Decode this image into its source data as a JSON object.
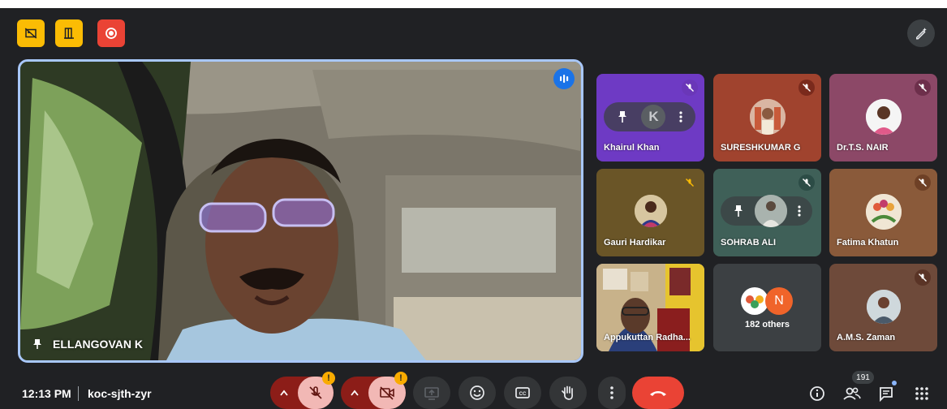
{
  "meeting": {
    "time": "12:13 PM",
    "code": "koc-sjth-zyr"
  },
  "colors": {
    "accent": "#a8c7fa",
    "hangup": "#ea4335",
    "warn": "#f9ab00",
    "yellow_chip": "#fbbc04",
    "red_chip": "#ea4335",
    "bg": "#202124"
  },
  "top_chips": [
    {
      "icon": "video-off-icon"
    },
    {
      "icon": "door-exit-icon"
    },
    {
      "icon": "record-icon"
    }
  ],
  "main_speaker": {
    "name": "ELLANGOVAN K",
    "icon": "pin-icon"
  },
  "participants": [
    {
      "name": "Khairul Khan",
      "initial": "K",
      "bg": "#6e3ac4",
      "mute_bg": "#6a37b8"
    },
    {
      "name": "SURESHKUMAR G",
      "bg": "#a0432e",
      "mute_bg": "#7a2a1c"
    },
    {
      "name": "Dr.T.S. NAIR",
      "bg": "#8c4867",
      "mute_bg": "#6d2f4b"
    },
    {
      "name": "Gauri Hardikar",
      "bg": "#6a5527",
      "mute_bg": "#6a5527"
    },
    {
      "name": "SOHRAB ALI",
      "bg": "#3f6058",
      "mute_bg": "#2c4c46"
    },
    {
      "name": "Fatima Khatun",
      "bg": "#8a5a3a",
      "mute_bg": "#6e4026"
    },
    {
      "name": "Appukuttan Radha...",
      "bg": "#a08a6c"
    },
    {
      "others_label": "182 others",
      "avatar_letter": "N",
      "bg": "#3c4043"
    },
    {
      "name": "A.M.S. Zaman",
      "bg": "#6e4a3a",
      "mute_bg": "#5a3426"
    }
  ],
  "controls": {
    "mic_warning": "!",
    "cam_warning": "!",
    "people_count": "191"
  }
}
